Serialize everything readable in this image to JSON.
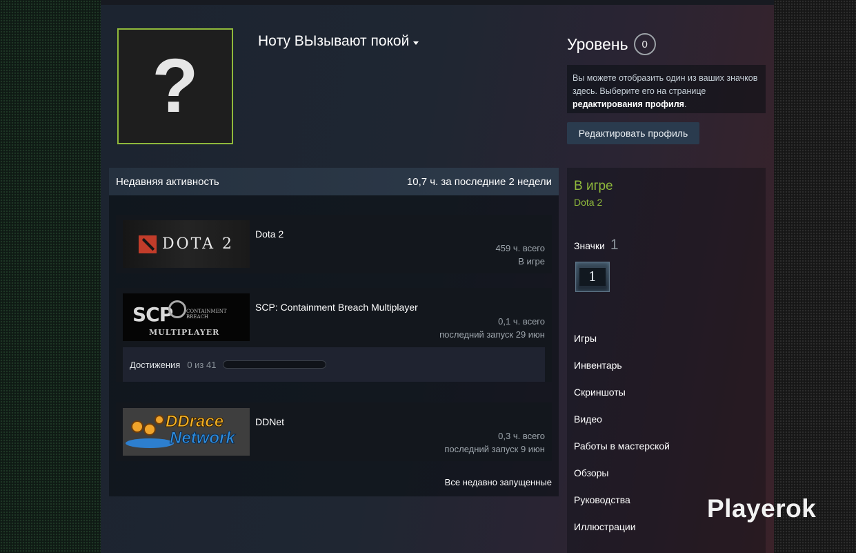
{
  "profile": {
    "username": "Hoтy ВЫзывают покой",
    "level_label": "Уровень",
    "level_value": "0",
    "badge_note_part1": "Вы можете отобразить один из ваших значков здесь. Выберите его на странице",
    "badge_note_link": "редактирования профиля",
    "badge_note_end": ".",
    "edit_profile": "Редактировать профиль",
    "avatar_glyph": "?"
  },
  "activity": {
    "header": "Недавняя активность",
    "summary": "10,7 ч. за последние 2 недели",
    "games": [
      {
        "title": "Dota 2",
        "hours": "459 ч. всего",
        "status": "В игре",
        "capsule_text": "DOTA 2"
      },
      {
        "title": "SCP: Containment Breach Multiplayer",
        "hours": "0,1 ч. всего",
        "status": "последний запуск 29 июн",
        "capsule_text": "SCP",
        "capsule_sub": "CONTAINMENT BREACH",
        "capsule_mp": "MULTIPLAYER",
        "achievements_label": "Достижения",
        "achievements_count": "0 из 41",
        "achievements_progress": 0
      },
      {
        "title": "DDNet",
        "hours": "0,3 ч. всего",
        "status": "последний запуск 9 июн",
        "capsule_line1": "DDrace",
        "capsule_line2": "Network"
      }
    ],
    "all_recent": "Все недавно запущенные"
  },
  "sidebar": {
    "ingame_label": "В игре",
    "ingame_game": "Dota 2",
    "badges_label": "Значки",
    "badges_count": "1",
    "badge_tile": "1",
    "links": [
      "Игры",
      "Инвентарь",
      "Скриншоты",
      "Видео",
      "Работы в мастерской",
      "Обзоры",
      "Руководства",
      "Иллюстрации"
    ]
  },
  "watermark": "Playerok",
  "colors": {
    "accent_green": "#8fb93b",
    "button_blue": "#2a3b4e"
  }
}
